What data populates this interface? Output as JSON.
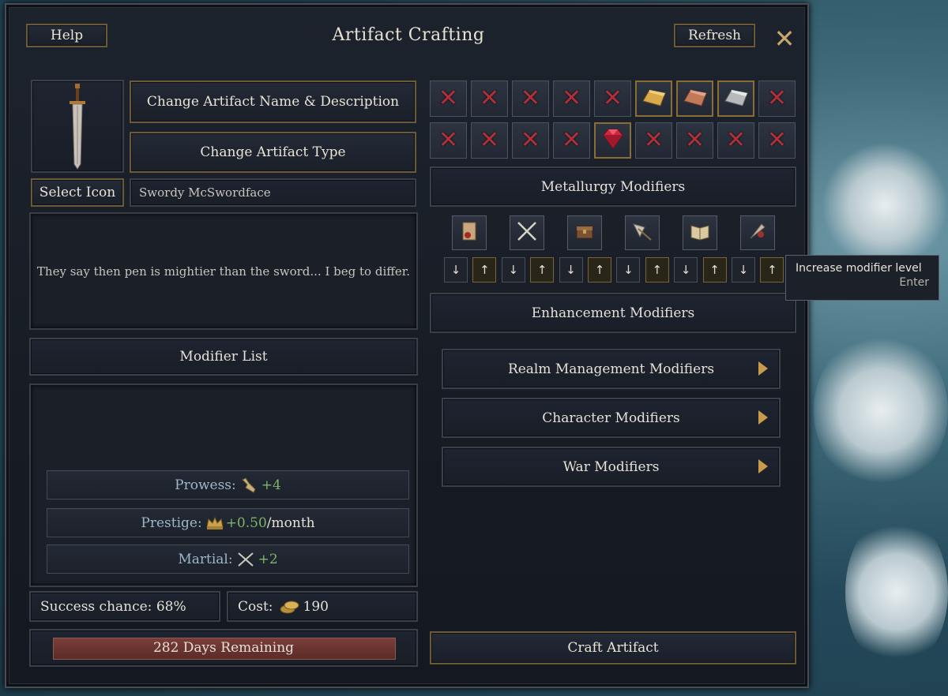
{
  "window": {
    "title": "Artifact Crafting",
    "help_label": "Help",
    "refresh_label": "Refresh",
    "close_glyph": "✕"
  },
  "left": {
    "change_name_label": "Change Artifact Name & Description",
    "change_type_label": "Change Artifact Type",
    "select_icon_label": "Select Icon",
    "name_value": "Swordy McSwordface",
    "description": "They say then pen is mightier than the sword... I beg to differ.",
    "modifier_list_label": "Modifier List",
    "modifiers": [
      {
        "label": "Prowess:",
        "icon": "prowess-icon",
        "value": "+4",
        "suffix": ""
      },
      {
        "label": "Prestige:",
        "icon": "crown-icon",
        "value": "+0.50",
        "suffix": "/month"
      },
      {
        "label": "Martial:",
        "icon": "crossed-swords-icon",
        "value": "+2",
        "suffix": ""
      }
    ],
    "success_chance": "Success chance: 68%",
    "cost_label": "Cost:",
    "cost_value": "190",
    "days_remaining": "282 Days Remaining"
  },
  "right": {
    "metallurgy_label": "Metallurgy Modifiers",
    "slot_rows": [
      [
        "x",
        "x",
        "x",
        "x",
        "x",
        "gold-ingot",
        "copper-ingot",
        "silver-ingot",
        "x"
      ],
      [
        "x",
        "x",
        "x",
        "x",
        "ruby",
        "x",
        "x",
        "x",
        "x"
      ]
    ],
    "enhancement_icons": [
      "scroll-icon",
      "crossed-swords-icon",
      "chest-icon",
      "axe-icon",
      "book-icon",
      "quill-icon"
    ],
    "arrows": [
      "↓",
      "↑",
      "↓",
      "↑",
      "↓",
      "↑",
      "↓",
      "↑",
      "↓",
      "↑",
      "↓",
      "↑"
    ],
    "enhancement_label": "Enhancement Modifiers",
    "tooltip_title": "Increase modifier level",
    "tooltip_key": "Enter",
    "categories": [
      "Realm Management Modifiers",
      "Character Modifiers",
      "War Modifiers"
    ],
    "craft_label": "Craft Artifact"
  },
  "colors": {
    "gold_border": "#6b5a37",
    "positive": "#7fb36a",
    "negative_x": "#b0303a",
    "progress": "#6e3733"
  }
}
